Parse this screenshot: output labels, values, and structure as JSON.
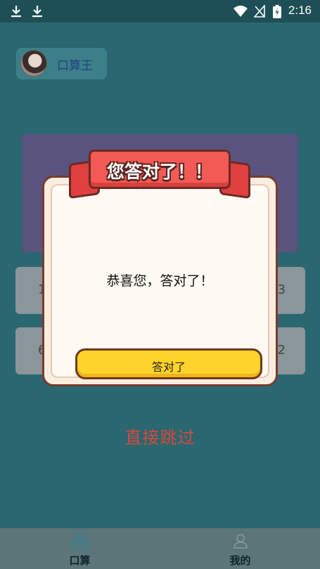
{
  "status_bar": {
    "time": "2:16"
  },
  "user": {
    "name": "口算王"
  },
  "options": [
    {
      "left": "1",
      "right": "3"
    },
    {
      "left": "6",
      "right": "2"
    }
  ],
  "skip_label": "直接跳过",
  "dialog": {
    "title": "您答对了！！",
    "message": "恭喜您，答对了！",
    "button_label": "答对了"
  },
  "bottom_nav": [
    {
      "label": "口算",
      "icon": "home-icon",
      "active": true
    },
    {
      "label": "我的",
      "icon": "person-icon",
      "active": false
    }
  ],
  "colors": {
    "background": "#2a6770",
    "skip": "#d8493b",
    "ribbon": "#f25a55",
    "button": "#ffd42a"
  }
}
